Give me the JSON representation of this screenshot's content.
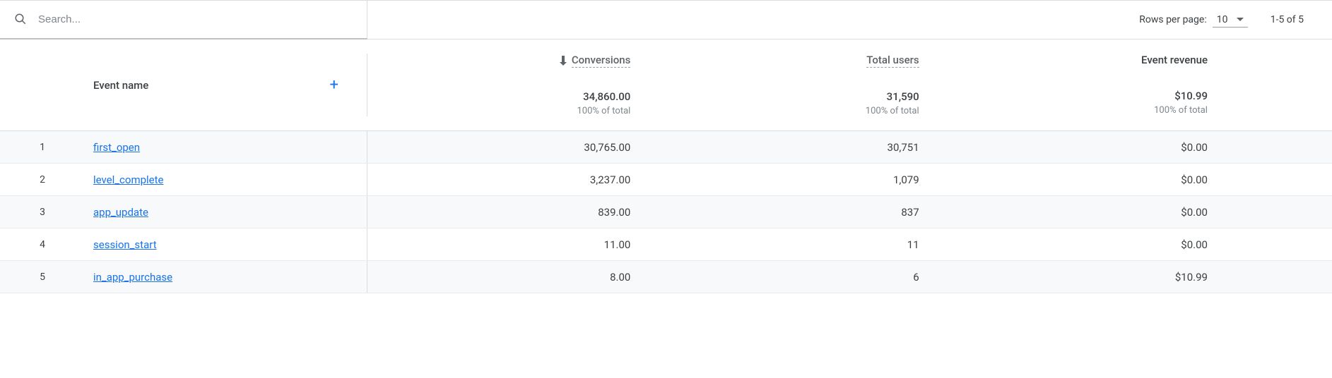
{
  "search": {
    "placeholder": "Search..."
  },
  "pagination": {
    "rows_label": "Rows per page:",
    "rows_value": "10",
    "range_text": "1-5 of 5"
  },
  "columns": {
    "event_name": "Event name",
    "conversions": "Conversions",
    "total_users": "Total users",
    "event_revenue": "Event revenue"
  },
  "totals": {
    "conversions": "34,860.00",
    "conversions_sub": "100% of total",
    "total_users": "31,590",
    "total_users_sub": "100% of total",
    "event_revenue": "$10.99",
    "event_revenue_sub": "100% of total"
  },
  "rows": [
    {
      "idx": "1",
      "name": "first_open",
      "conversions": "30,765.00",
      "total_users": "30,751",
      "event_revenue": "$0.00"
    },
    {
      "idx": "2",
      "name": "level_complete",
      "conversions": "3,237.00",
      "total_users": "1,079",
      "event_revenue": "$0.00"
    },
    {
      "idx": "3",
      "name": "app_update",
      "conversions": "839.00",
      "total_users": "837",
      "event_revenue": "$0.00"
    },
    {
      "idx": "4",
      "name": "session_start",
      "conversions": "11.00",
      "total_users": "11",
      "event_revenue": "$0.00"
    },
    {
      "idx": "5",
      "name": "in_app_purchase",
      "conversions": "8.00",
      "total_users": "6",
      "event_revenue": "$10.99"
    }
  ]
}
